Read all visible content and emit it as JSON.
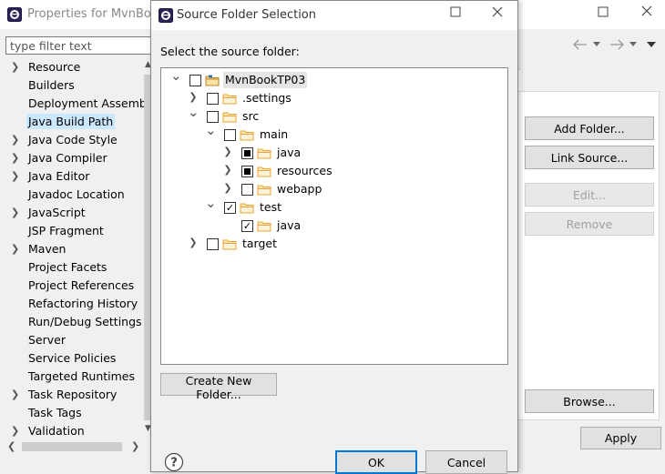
{
  "properties_window": {
    "title": "Properties for MvnBook",
    "controls": {
      "minimize": "—",
      "maximize": "☐",
      "close": "✕"
    },
    "filter": {
      "placeholder": "type filter text",
      "value": ""
    },
    "nav_items": [
      {
        "label": "Resource",
        "expandable": true
      },
      {
        "label": "Builders",
        "expandable": false
      },
      {
        "label": "Deployment Assembly",
        "expandable": false
      },
      {
        "label": "Java Build Path",
        "expandable": false,
        "selected": true
      },
      {
        "label": "Java Code Style",
        "expandable": true
      },
      {
        "label": "Java Compiler",
        "expandable": true
      },
      {
        "label": "Java Editor",
        "expandable": true
      },
      {
        "label": "Javadoc Location",
        "expandable": false
      },
      {
        "label": "JavaScript",
        "expandable": true
      },
      {
        "label": "JSP Fragment",
        "expandable": false
      },
      {
        "label": "Maven",
        "expandable": true
      },
      {
        "label": "Project Facets",
        "expandable": false
      },
      {
        "label": "Project References",
        "expandable": false
      },
      {
        "label": "Refactoring History",
        "expandable": false
      },
      {
        "label": "Run/Debug Settings",
        "expandable": false
      },
      {
        "label": "Server",
        "expandable": false
      },
      {
        "label": "Service Policies",
        "expandable": false
      },
      {
        "label": "Targeted Runtimes",
        "expandable": false
      },
      {
        "label": "Task Repository",
        "expandable": true
      },
      {
        "label": "Task Tags",
        "expandable": false
      },
      {
        "label": "Validation",
        "expandable": true
      }
    ],
    "buttons": {
      "add_folder": "Add Folder...",
      "link_source": "Link Source...",
      "edit": "Edit...",
      "remove": "Remove",
      "browse": "Browse...",
      "apply": "Apply"
    }
  },
  "dialog": {
    "title": "Source Folder Selection",
    "prompt": "Select the source folder:",
    "tree": [
      {
        "label": "MvnBookTP03",
        "depth": 0,
        "expander": "open",
        "check": "unchecked",
        "icon": "project-icon"
      },
      {
        "label": ".settings",
        "depth": 1,
        "expander": "closed",
        "check": "unchecked",
        "icon": "folder-icon"
      },
      {
        "label": "src",
        "depth": 1,
        "expander": "open",
        "check": "unchecked",
        "icon": "folder-icon"
      },
      {
        "label": "main",
        "depth": 2,
        "expander": "open",
        "check": "unchecked",
        "icon": "folder-icon"
      },
      {
        "label": "java",
        "depth": 3,
        "expander": "closed",
        "check": "partial",
        "icon": "folder-icon"
      },
      {
        "label": "resources",
        "depth": 3,
        "expander": "closed",
        "check": "partial",
        "icon": "folder-icon"
      },
      {
        "label": "webapp",
        "depth": 3,
        "expander": "closed",
        "check": "unchecked",
        "icon": "folder-icon"
      },
      {
        "label": "test",
        "depth": 2,
        "expander": "open",
        "check": "checked",
        "icon": "folder-icon"
      },
      {
        "label": "java",
        "depth": 3,
        "expander": "none",
        "check": "checked",
        "icon": "folder-icon"
      },
      {
        "label": "target",
        "depth": 1,
        "expander": "closed",
        "check": "unchecked",
        "icon": "folder-icon"
      }
    ],
    "create_folder_label": "Create New Folder...",
    "ok_label": "OK",
    "cancel_label": "Cancel"
  },
  "colors": {
    "selection": "#cce8ff",
    "folder": "#e8a53a",
    "accent": "#0078d7"
  }
}
